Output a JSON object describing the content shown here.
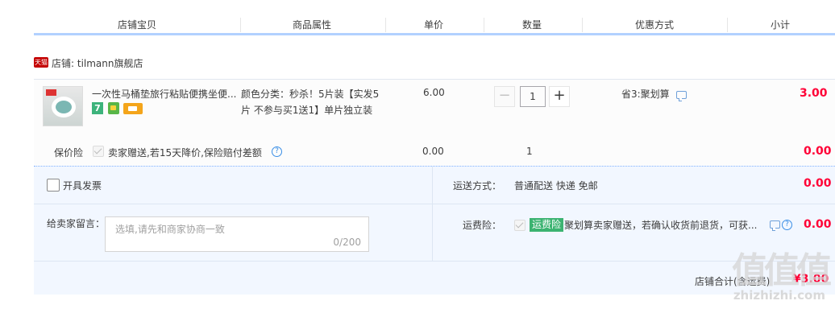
{
  "header": {
    "columns": [
      "店铺宝贝",
      "商品属性",
      "单价",
      "数量",
      "优惠方式",
      "小计"
    ]
  },
  "shop": {
    "badge": "天猫",
    "name": "店铺: tilmann旗舰店"
  },
  "item": {
    "title": "一次性马桶垫旅行粘贴便携坐便...",
    "badges": [
      "7",
      "cart-badge-icon",
      "card-badge-icon"
    ],
    "attr_line1": "颜色分类：秒杀！5片装【实发5",
    "attr_line2": "片 不参与买1送1】单片独立装",
    "price": "6.00",
    "quantity": "1",
    "minus": "−",
    "plus": "+",
    "promo": "省3:聚划算",
    "subtotal": "3.00"
  },
  "insurance": {
    "label": "保价险",
    "text": "卖家赠送,若15天降价,保险赔付差额",
    "help": "?",
    "price": "0.00",
    "quantity": "1",
    "subtotal": "0.00"
  },
  "invoice": {
    "label": "开具发票",
    "fee": "0.00"
  },
  "shipping": {
    "label": "运送方式：",
    "value": "普通配送 快递 免邮"
  },
  "message": {
    "label": "给卖家留言：",
    "placeholder": "选填,请先和商家协商一致",
    "count": "0/200"
  },
  "freight_insurance": {
    "label": "运费险：",
    "tag": "运费险",
    "text": "聚划算卖家赠送，若确认收货前退货，可获...",
    "help": "?",
    "subtotal": "0.00"
  },
  "shop_total": {
    "label": "店铺合计(含运费)",
    "value": "¥3.00"
  },
  "watermark": {
    "logo": "值值值",
    "url": "zhizhizhi.com"
  },
  "colors": {
    "accent_blue": "#b2d1ff",
    "price_red": "#ff0036",
    "tmall_red": "#c40000",
    "freight_green": "#3cb371",
    "extra_bg": "#f2f7ff"
  }
}
